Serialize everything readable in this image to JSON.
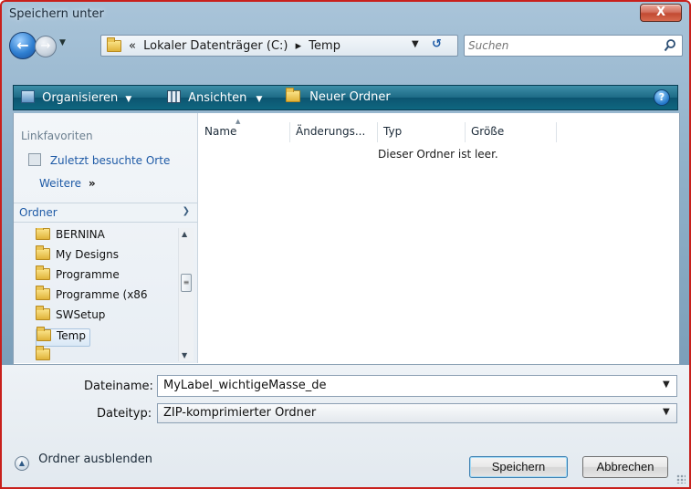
{
  "window": {
    "title": "Speichern unter",
    "close_label": "X"
  },
  "address": {
    "overflow": "«",
    "drive": "Lokaler Datenträger (C:)",
    "separator": "▸",
    "folder": "Temp"
  },
  "search": {
    "placeholder": "Suchen"
  },
  "toolbar": {
    "organize": "Organisieren",
    "views": "Ansichten",
    "new_folder": "Neuer Ordner",
    "dropdown_glyph": "▼",
    "help_glyph": "?"
  },
  "nav": {
    "favorites_title": "Linkfavoriten",
    "recent_places": "Zuletzt besuchte Orte",
    "more": "Weitere",
    "more_glyph": "»",
    "folders_label": "Ordner",
    "tree": [
      {
        "label": "BERNINA",
        "selected": false
      },
      {
        "label": "My Designs",
        "selected": false
      },
      {
        "label": "Programme",
        "selected": false
      },
      {
        "label": "Programme (x86",
        "selected": false
      },
      {
        "label": "SWSetup",
        "selected": false
      },
      {
        "label": "Temp",
        "selected": true
      }
    ]
  },
  "filelist": {
    "columns": [
      "Name",
      "Änderungs...",
      "Typ",
      "Größe"
    ],
    "sorted_column": "Name",
    "empty_message": "Dieser Ordner ist leer."
  },
  "form": {
    "filename_label": "Dateiname:",
    "filename_value": "MyLabel_wichtigeMasse_de",
    "filetype_label": "Dateityp:",
    "filetype_value": "ZIP-komprimierter Ordner"
  },
  "footer": {
    "hide_folders": "Ordner ausblenden",
    "save": "Speichern",
    "cancel": "Abbrechen"
  },
  "colors": {
    "toolbar": "#1d6b86",
    "link": "#1e5aa6",
    "window_border": "#c8201c"
  }
}
